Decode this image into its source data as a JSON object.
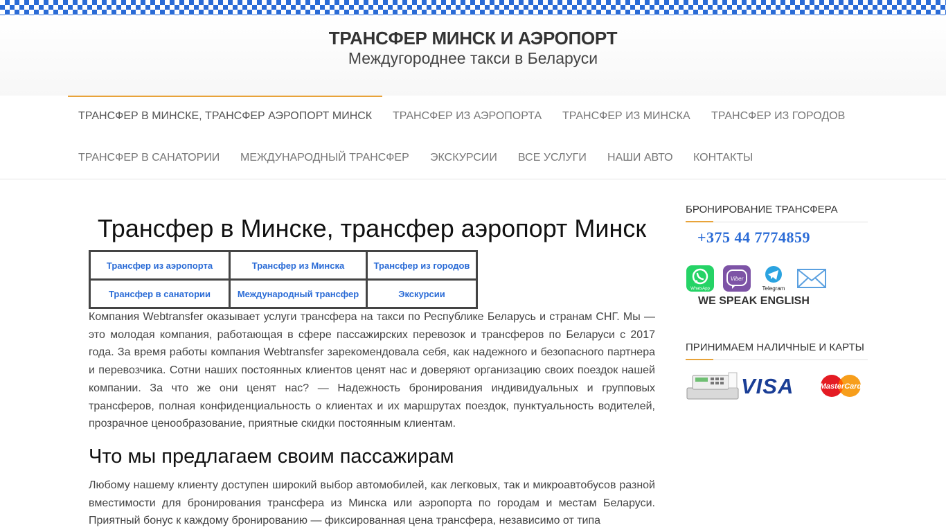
{
  "header": {
    "site_title": "ТРАНСФЕР МИНСК И АЭРОПОРТ",
    "tagline": "Междугороднее такси в Беларуси"
  },
  "nav": {
    "row1": [
      "ТРАНСФЕР В МИНСКЕ, ТРАНСФЕР АЭРОПОРТ МИНСК",
      "ТРАНСФЕР ИЗ АЭРОПОРТА",
      "ТРАНСФЕР ИЗ МИНСКА",
      "ТРАНСФЕР ИЗ ГОРОДОВ"
    ],
    "row2": [
      "ТРАНСФЕР В САНАТОРИИ",
      "МЕЖДУНАРОДНЫЙ ТРАНСФЕР",
      "ЭКСКУРСИИ",
      "ВСЕ УСЛУГИ",
      "НАШИ АВТО",
      "КОНТАКТЫ"
    ]
  },
  "main": {
    "title": "Трансфер в Минске, трансфер аэропорт Минск",
    "links_table": [
      [
        "Трансфер из аэропорта",
        "Трансфер из Минска",
        "Трансфер из городов"
      ],
      [
        "Трансфер в санатории",
        "Международный трансфер",
        "Экскурсии"
      ]
    ],
    "paragraph1": "Компания Webtransfer оказывает услуги трансфера на такси по Республике Беларусь и странам СНГ. Мы — это молодая компания, работающая в сфере пассажирских перевозок и трансферов по Беларуси с 2017 года. За время работы компания Webtransfer зарекомендовала себя, как надежного и безопасного партнера и перевозчика. Сотни наших постоянных клиентов ценят нас и доверяют организацию своих поездок нашей компании. За что же они ценят нас? — Надежность бронирования индивидуальных и групповых трансферов, полная конфиденциальность о клиентах и их маршрутах поездок, пунктуальность водителей, прозрачное ценообразование, приятные скидки постоянным клиентам.",
    "heading2": "Что мы предлагаем своим пассажирам",
    "paragraph2": "Любому нашему клиенту доступен широкий выбор автомобилей, как легковых, так и микроавтобусов разной вместимости для бронирования трансфера из Минска или аэропорта по городам и местам Беларуси. Приятный бонус к каждому бронированию — фиксированная цена трансфера, независимо от типа"
  },
  "sidebar": {
    "booking_title": "БРОНИРОВАНИЕ ТРАНСФЕРА",
    "phone": "+375 44 7774859",
    "messengers": {
      "whatsapp": "WhatsApp",
      "viber": "Viber",
      "telegram": "Telegram"
    },
    "speak": "WE SPEAK ENGLISH",
    "payment_title": "ПРИНИМАЕМ НАЛИЧНЫЕ И КАРТЫ",
    "visa": "VISA",
    "mastercard": "MasterCard"
  },
  "colors": {
    "accent": "#e8a33a",
    "link": "#2a6bd6",
    "whatsapp": "#25d366",
    "viber": "#7d53a6",
    "telegram": "#2ba3e0",
    "mastercard_red": "#e41b23",
    "mastercard_yellow": "#f79e1b"
  }
}
